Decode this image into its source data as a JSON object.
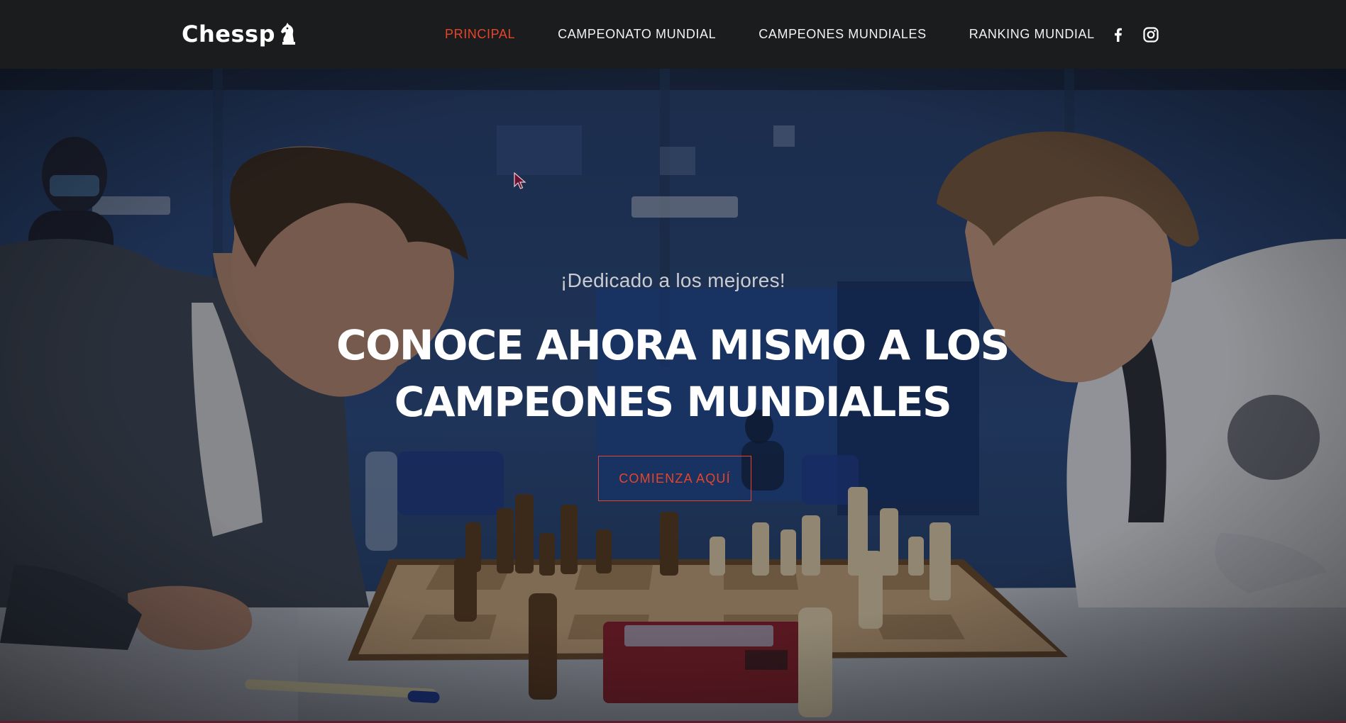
{
  "brand": {
    "name": "Chessp",
    "icon": "chess-knight-icon"
  },
  "nav": {
    "items": [
      {
        "label": "PRINCIPAL",
        "active": true
      },
      {
        "label": "CAMPEONATO MUNDIAL",
        "active": false
      },
      {
        "label": "CAMPEONES MUNDIALES",
        "active": false
      },
      {
        "label": "RANKING MUNDIAL",
        "active": false
      }
    ],
    "social": [
      {
        "icon": "facebook-icon"
      },
      {
        "icon": "instagram-icon"
      }
    ]
  },
  "hero": {
    "tagline": "¡Dedicado a los mejores!",
    "title": "CONOCE AHORA MISMO A LOS CAMPEONES MUNDIALES",
    "cta_label": "COMIENZA AQUÍ",
    "background_scene": "Chess match photo: two players facing each other across a wooden chessboard with a digital clock"
  },
  "colors": {
    "accent": "#e8442a",
    "navbar_bg": "#1b1c1e",
    "nav_text": "#f2f2f2",
    "hero_title": "#ffffff"
  }
}
